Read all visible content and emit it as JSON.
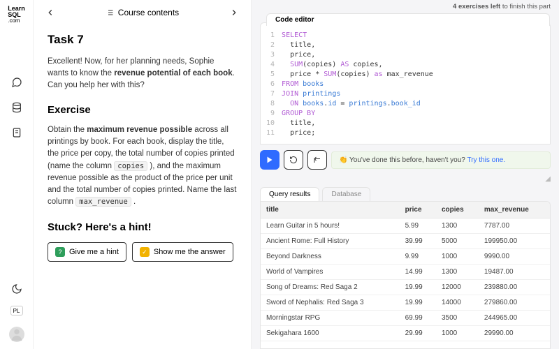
{
  "logo": {
    "line1": "Learn",
    "line2": "SQL",
    "sub": ".com"
  },
  "topnav": {
    "title": "Course contents"
  },
  "progress": {
    "prefix": "4 exercises left",
    "suffix": " to finish this part"
  },
  "task": {
    "title": "Task 7",
    "intro_pre": "Excellent! Now, for her planning needs, Sophie wants to know the ",
    "intro_bold": "revenue potential of each book",
    "intro_post": ". Can you help her with this?",
    "exercise_h": "Exercise",
    "ex_p1_pre": "Obtain the ",
    "ex_p1_bold": "maximum revenue possible",
    "ex_p1_mid": " across all printings by book. For each book, display the title, the price per copy, the total number of copies printed (name the column ",
    "ex_code1": "copies",
    "ex_p1_mid2": " ), and the maximum revenue possible as the product of the price per unit and the total number of copies printed. Name the last column ",
    "ex_code2": "max_revenue",
    "ex_p1_end": " .",
    "hint_h": "Stuck? Here's a hint!",
    "hint_btn": "Give me a hint",
    "answer_btn": "Show me the answer"
  },
  "editor": {
    "tab": "Code editor",
    "lines": [
      "SELECT",
      "  title,",
      "  price,",
      "  SUM(copies) AS copies,",
      "  price * SUM(copies) as max_revenue",
      "FROM books",
      "JOIN printings",
      "  ON books.id = printings.book_id",
      "GROUP BY",
      "  title,",
      "  price;"
    ]
  },
  "done_before": {
    "lead": "👏 You've done this before, haven't you? ",
    "link": "Try this one."
  },
  "results": {
    "tab1": "Query results",
    "tab2": "Database",
    "columns": [
      "title",
      "price",
      "copies",
      "max_revenue"
    ],
    "rows": [
      [
        "Learn Guitar in 5 hours!",
        "5.99",
        "1300",
        "7787.00"
      ],
      [
        "Ancient Rome: Full History",
        "39.99",
        "5000",
        "199950.00"
      ],
      [
        "Beyond Darkness",
        "9.99",
        "1000",
        "9990.00"
      ],
      [
        "World of Vampires",
        "14.99",
        "1300",
        "19487.00"
      ],
      [
        "Song of Dreams: Red Saga 2",
        "19.99",
        "12000",
        "239880.00"
      ],
      [
        "Sword of Nephalis: Red Saga 3",
        "19.99",
        "14000",
        "279860.00"
      ],
      [
        "Morningstar RPG",
        "69.99",
        "3500",
        "244965.00"
      ],
      [
        "Sekigahara 1600",
        "29.99",
        "1000",
        "29990.00"
      ]
    ]
  }
}
